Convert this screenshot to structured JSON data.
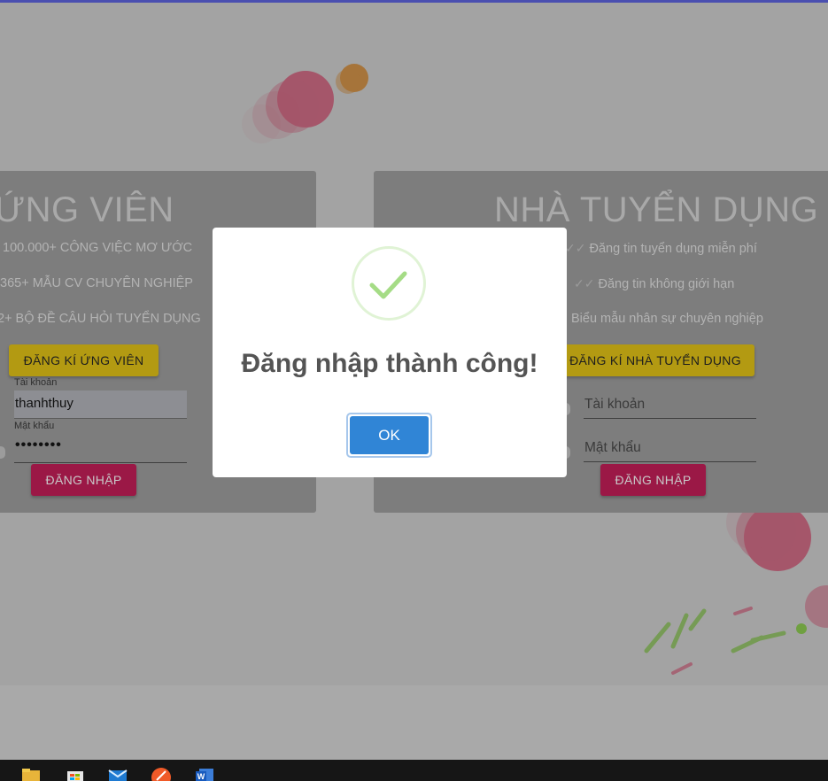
{
  "candidate": {
    "title": "ỨNG VIÊN",
    "features": [
      "100.000+ CÔNG VIỆC MƠ ƯỚC",
      "365+ MẪU CV CHUYÊN NGHIỆP",
      "2+ BỘ ĐỀ CÂU HỎI TUYỂN DỤNG"
    ],
    "register_label": "ĐĂNG KÍ ỨNG VIÊN",
    "username_label": "Tài khoản",
    "username_value": "thanhthuy",
    "password_label": "Mật khẩu",
    "password_value": "••••••••",
    "login_label": "ĐĂNG NHẬP"
  },
  "employer": {
    "title": "NHÀ TUYỂN DỤNG",
    "features": [
      "Đăng tin tuyển dụng miễn phí",
      "Đăng tin không giới hạn",
      "Biểu mẫu nhân sự chuyên nghiệp"
    ],
    "register_label": "ĐĂNG KÍ NHÀ TUYỂN DỤNG",
    "username_placeholder": "Tài khoản",
    "password_placeholder": "Mật khẩu",
    "login_label": "ĐĂNG NHẬP"
  },
  "dialog": {
    "title": "Đăng nhập thành công!",
    "ok_label": "OK",
    "icon": "success-check-icon",
    "accent_color": "#3085d6",
    "check_color": "#a5dc86"
  },
  "taskbar": {
    "icons": [
      "file-explorer-icon",
      "microsoft-store-icon",
      "mail-icon",
      "brave-browser-icon",
      "word-icon"
    ]
  }
}
